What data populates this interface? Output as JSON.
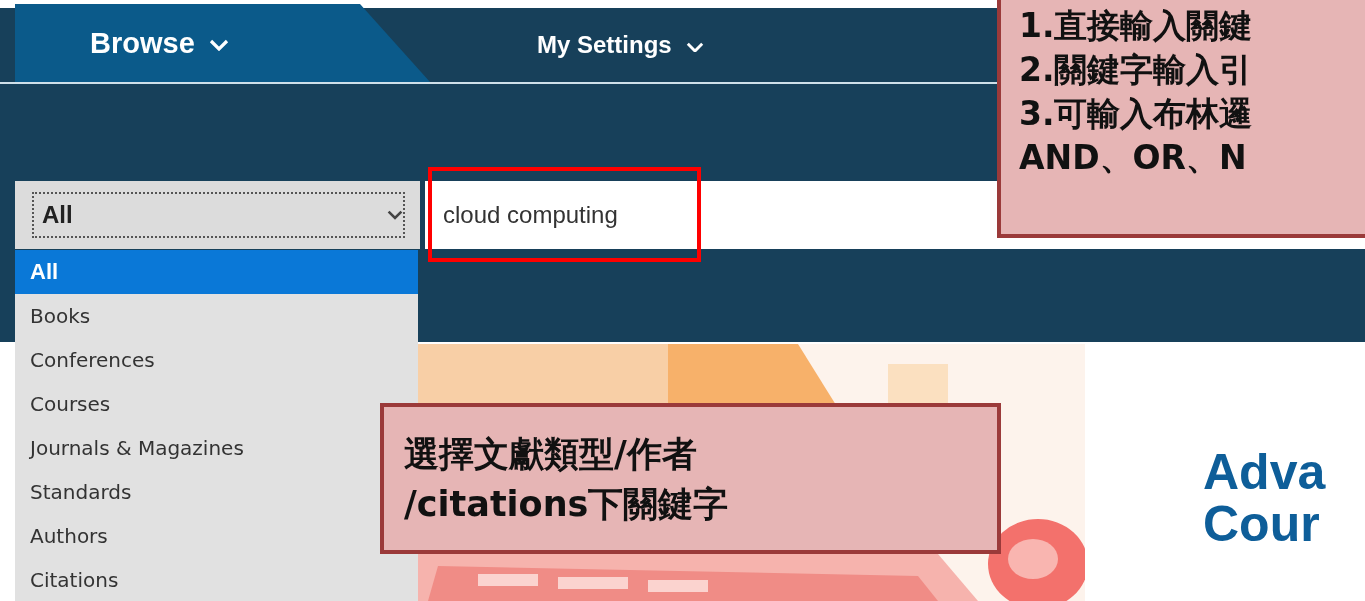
{
  "nav": {
    "tabs": [
      {
        "label": "Browse",
        "selected": true
      },
      {
        "label": "My Settings",
        "selected": false
      }
    ]
  },
  "search": {
    "scope": "All",
    "query": "cloud computing",
    "highlighted": true
  },
  "scope_menu": {
    "options": [
      {
        "label": "All",
        "selected": true
      },
      {
        "label": "Books",
        "selected": false
      },
      {
        "label": "Conferences",
        "selected": false
      },
      {
        "label": "Courses",
        "selected": false
      },
      {
        "label": "Journals & Magazines",
        "selected": false
      },
      {
        "label": "Standards",
        "selected": false
      },
      {
        "label": "Authors",
        "selected": false
      },
      {
        "label": "Citations",
        "selected": false
      }
    ]
  },
  "hero": {
    "heading_lines": [
      "Adva",
      "Cour"
    ]
  },
  "callouts": [
    {
      "kind": "top",
      "lines": [
        "1.直接輸入關鍵",
        "2.關鍵字輸入引",
        "3.可輸入布林邏",
        "AND、OR、N"
      ]
    },
    {
      "kind": "middle",
      "lines": [
        "選擇文獻類型/作者",
        "/citations下關鍵字"
      ]
    }
  ]
}
